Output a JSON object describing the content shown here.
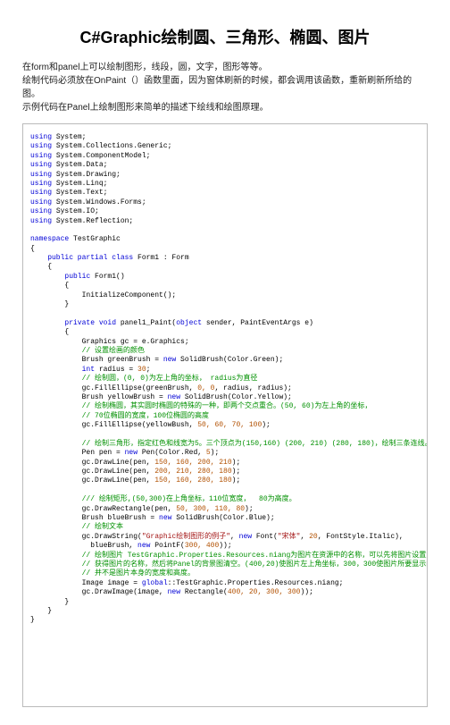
{
  "title": "C#Graphic绘制圆、三角形、椭圆、图片",
  "intro_lines": [
    "在form和panel上可以绘制图形，线段，圆，文字，图形等等。",
    "绘制代码必须放在OnPaint（）函数里面，因为窗体刷新的时候，都会调用该函数，重新刷新所给的图。",
    "示例代码在Panel上绘制图形来简单的描述下绘线和绘图原理。"
  ],
  "code": {
    "usings": [
      "System;",
      "System.Collections.Generic;",
      "System.ComponentModel;",
      "System.Data;",
      "System.Drawing;",
      "System.Linq;",
      "System.Text;",
      "System.Windows.Forms;",
      "System.IO;",
      "System.Reflection;"
    ],
    "namespace_kw": "namespace",
    "namespace_name": " TestGraphic",
    "class_decl": {
      "mods": "public partial class",
      "name": " Form1 : Form"
    },
    "ctor_decl": {
      "mods": "public",
      "name": " Form1()"
    },
    "ctor_body": "InitializeComponent();",
    "paint_decl": {
      "mods": "private void",
      "name": " panel1_Paint(",
      "obj_kw": "object",
      "rest": " sender, PaintEventArgs e)"
    },
    "lines": {
      "l1": "Graphics gc = e.Graphics;",
      "c1": "// 设置绘画的颜色",
      "l2a": "Brush greenBrush = ",
      "l2b": " SolidBrush(Color.Green);",
      "l3a": " radius = ",
      "l3b": ";",
      "c2": "// 绘制圆，(0, 0)为左上角的坐标， radius为直径",
      "l4a": "gc.FillEllipse(greenBrush, ",
      "l4b": ", radius, radius);",
      "l5a": "Brush yellowBrush = ",
      "l5b": " SolidBrush(Color.Yellow);",
      "c3": "// 绘制椭圆，其实圆时椭圆的特殊的一种，即两个交点重合。(50, 60)为左上角的坐标，",
      "c4": "// 70位椭圆的宽度，100位椭圆的高度",
      "l6a": "gc.FillEllipse(yellowBush, ",
      "l6b": ");",
      "c5": "// 绘制三角形，指定红色和线宽为5。三个顶点为(150,160) (200, 210) (280, 180)，绘制三条连线。",
      "l7a": "Pen pen = ",
      "l7b": " Pen(Color.Red, ",
      "l7c": ");",
      "l8a": "gc.DrawLine(pen, ",
      "l8b": ");",
      "l9a": "gc.DrawLine(pen, ",
      "l9b": ");",
      "l10a": "gc.DrawLine(pen, ",
      "l10b": ");",
      "c6": "/// 绘制矩形,(50,300)在上角坐标，110位宽度，  80为高度。",
      "l11a": "gc.DrawRectangle(pen, ",
      "l11b": ");",
      "l12a": "Brush blueBrush = ",
      "l12b": " SolidBrush(Color.Blue);",
      "c7": "// 绘制文本",
      "l13a": "gc.DrawString(",
      "l13b": ", ",
      "l13c": " Font(",
      "l13d": ", ",
      "l13e": ", FontStyle.Italic),",
      "l14a": "  blueBrush, ",
      "l14b": " PointF(",
      "l14c": "));",
      "c8": "// 绘制图片 TestGraphic.Properties.Resources.niang为图片在资源中的名称，可以先将图片设置为Panel的背景图,",
      "c9": "// 获得图片的名称，然后将Panel的背景图清空。(400,20)使图片左上角坐标，300，300使图片所要显示的宽度和高度,",
      "c10": "// 并不是图片本身的宽度和高度。",
      "l15a": "Image image = ",
      "l15b": "::TestGraphic.Properties.Resources.niang;",
      "l16a": "gc.DrawImage(image, ",
      "l16b": " Rectangle(",
      "l16c": "));"
    },
    "nums": {
      "n30": "30",
      "n00": "0, 0",
      "n50607010": "50, 60, 70, 100",
      "n5": "5",
      "n150160200210": "150, 160, 200, 210",
      "n200210280180": "200, 210, 280, 180",
      "n150160280180": "150, 160, 280, 180",
      "n5030011080": "50, 300, 110, 80",
      "n20": "20",
      "n300400": "300, 400",
      "n40020300300": "400, 20, 300, 300"
    },
    "strings": {
      "s1": "\"Graphic绘制图形的例子\"",
      "s2": "\"宋体\""
    },
    "kw": {
      "using": "using",
      "new": "new",
      "int": "int",
      "global": "global"
    }
  }
}
